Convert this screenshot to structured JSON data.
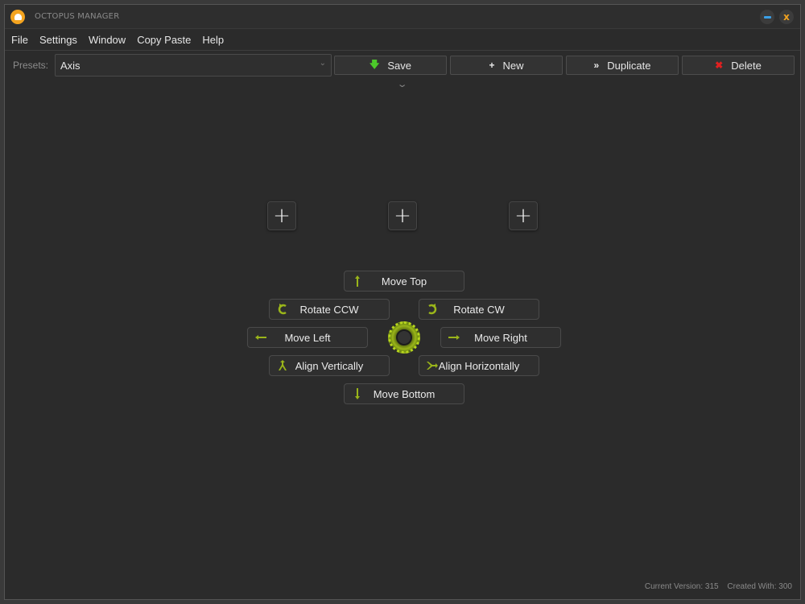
{
  "window": {
    "title": "OCTOPUS MANAGER"
  },
  "menu": [
    "File",
    "Settings",
    "Window",
    "Copy Paste",
    "Help"
  ],
  "toolbar": {
    "presets_label": "Presets:",
    "preset_value": "Axis",
    "save_label": "Save",
    "new_label": "New",
    "duplicate_label": "Duplicate",
    "delete_label": "Delete"
  },
  "actions": {
    "move_top": "Move Top",
    "rotate_ccw": "Rotate CCW",
    "rotate_cw": "Rotate CW",
    "move_left": "Move Left",
    "move_right": "Move Right",
    "align_vertically": "Align Vertically",
    "align_horizontally": "Align Horizontally",
    "move_bottom": "Move Bottom"
  },
  "footer": {
    "current_version": "Current Version: 315",
    "created_with": "Created With: 300"
  },
  "colors": {
    "accent_green": "#9ab51a",
    "logo_orange": "#f4a41f",
    "minimize_blue": "#3aa0e8",
    "delete_red": "#e02020",
    "background": "#2b2b2b"
  },
  "icons": {
    "save": "arrow-down-icon",
    "new": "plus-icon",
    "duplicate": "double-chevron-right-icon",
    "delete": "x-icon"
  }
}
